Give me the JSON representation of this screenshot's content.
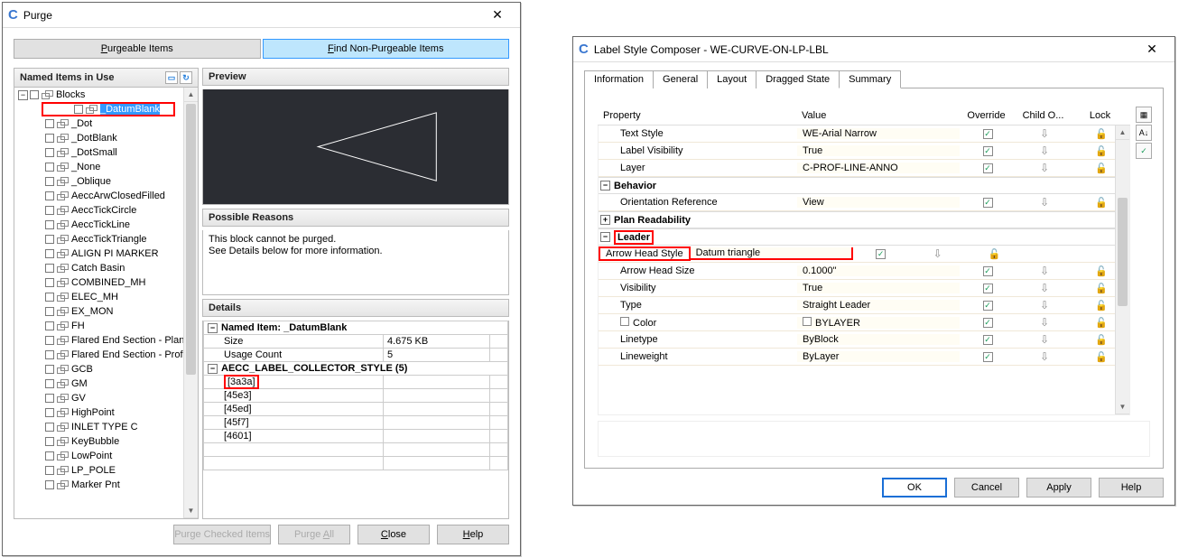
{
  "win1": {
    "title": "Purge",
    "btn_purgeable": "Purgeable Items",
    "btn_findnon_pre": "F",
    "btn_findnon": "ind Non-Purgeable Items",
    "hdr_named": "Named Items in Use",
    "hdr_preview": "Preview",
    "hdr_reasons": "Possible Reasons",
    "reasons_l1": "This block cannot be purged.",
    "reasons_l2": "See Details below for more information.",
    "hdr_details": "Details",
    "tree": {
      "root": "Blocks",
      "items": [
        "_DatumBlank",
        "_Dot",
        "_DotBlank",
        "_DotSmall",
        "_None",
        "_Oblique",
        "AeccArwClosedFilled",
        "AeccTickCircle",
        "AeccTickLine",
        "AeccTickTriangle",
        "ALIGN PI MARKER",
        "Catch Basin",
        "COMBINED_MH",
        "ELEC_MH",
        "EX_MON",
        "FH",
        "Flared End Section - Plan",
        "Flared End Section - Prof",
        "GCB",
        "GM",
        "GV",
        "HighPoint",
        "INLET TYPE C",
        "KeyBubble",
        "LowPoint",
        "LP_POLE",
        "Marker Pnt"
      ]
    },
    "details": {
      "named_item": "Named Item: _DatumBlank",
      "row_size_k": "Size",
      "row_size_v": "4.675 KB",
      "row_usage_k": "Usage Count",
      "row_usage_v": "5",
      "grp": "AECC_LABEL_COLLECTOR_STYLE (5)",
      "cells": [
        "[3a3a]",
        "[45e3]",
        "[45ed]",
        "[45f7]",
        "[4601]"
      ]
    },
    "btn_purge": "Purge Checked Items",
    "btn_purgeall_pre": "Purge ",
    "btn_purgeall": "A",
    "btn_purgeall_post": "ll",
    "btn_close_pre": "",
    "btn_close": "C",
    "btn_close_post": "lose",
    "btn_help_pre": "",
    "btn_help": "H",
    "btn_help_post": "elp"
  },
  "win2": {
    "title": "Label Style Composer - WE-CURVE-ON-LP-LBL",
    "tabs": [
      "Information",
      "General",
      "Layout",
      "Dragged State",
      "Summary"
    ],
    "active_tab": "Summary",
    "cols": {
      "prop": "Property",
      "val": "Value",
      "ov": "Override",
      "ch": "Child O...",
      "lk": "Lock"
    },
    "rows": [
      {
        "type": "item",
        "prop": "Text Style",
        "val": "WE-Arial Narrow",
        "indent": 1
      },
      {
        "type": "item",
        "prop": "Label Visibility",
        "val": "True",
        "indent": 1
      },
      {
        "type": "item",
        "prop": "Layer",
        "val": "C-PROF-LINE-ANNO",
        "indent": 1
      },
      {
        "type": "group",
        "label": "Behavior",
        "state": "-"
      },
      {
        "type": "item",
        "prop": "Orientation Reference",
        "val": "View",
        "indent": 1
      },
      {
        "type": "group",
        "label": "Plan Readability",
        "state": "+"
      },
      {
        "type": "group",
        "label": "Leader",
        "state": "-",
        "highlight": true
      },
      {
        "type": "item",
        "prop": "Arrow Head Style",
        "val": "Datum triangle",
        "indent": 1,
        "highlight": true
      },
      {
        "type": "item",
        "prop": "Arrow Head Size",
        "val": "0.1000\"",
        "indent": 1
      },
      {
        "type": "item",
        "prop": "Visibility",
        "val": "True",
        "indent": 1
      },
      {
        "type": "item",
        "prop": "Type",
        "val": "Straight Leader",
        "indent": 1
      },
      {
        "type": "item",
        "prop": "Color",
        "val": "BYLAYER",
        "indent": 1,
        "colorbox": true
      },
      {
        "type": "item",
        "prop": "Linetype",
        "val": "ByBlock",
        "indent": 1
      },
      {
        "type": "item",
        "prop": "Lineweight",
        "val": "ByLayer",
        "indent": 1
      }
    ],
    "btn_ok": "OK",
    "btn_cancel": "Cancel",
    "btn_apply": "Apply",
    "btn_help": "Help"
  }
}
